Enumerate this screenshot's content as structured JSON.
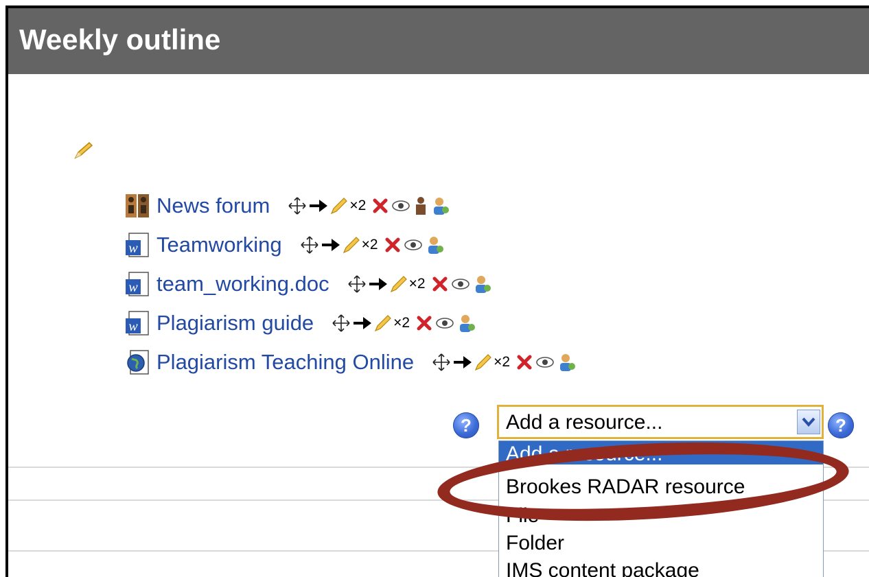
{
  "header": {
    "title": "Weekly outline"
  },
  "section": {
    "edit_icon": "pencil-icon"
  },
  "activities": [
    {
      "label": "News forum",
      "type": "forum"
    },
    {
      "label": "Teamworking",
      "type": "word-doc"
    },
    {
      "label": "team_working.doc",
      "type": "word-doc"
    },
    {
      "label": "Plagiarism guide",
      "type": "word-doc"
    },
    {
      "label": "Plagiarism Teaching Online",
      "type": "url"
    }
  ],
  "controls": {
    "duplicate_label": "×2"
  },
  "add_resource": {
    "selected": "Add a resource...",
    "options": [
      "Add a resource...",
      "Brookes RADAR resource",
      "File",
      "Folder",
      "IMS content package"
    ]
  },
  "colors": {
    "header_bg": "#646464",
    "link": "#2249a3",
    "highlight": "#922a20",
    "select_border": "#e0b23c"
  }
}
